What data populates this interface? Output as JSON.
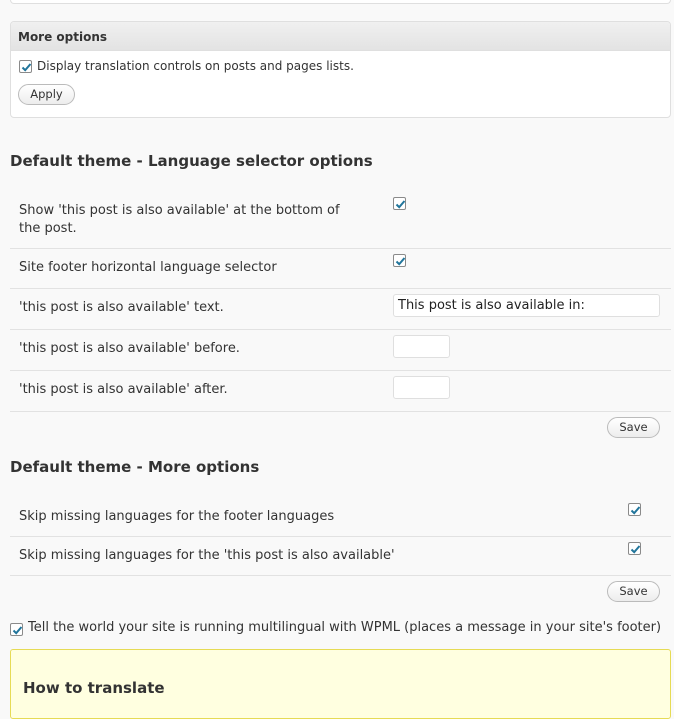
{
  "more_options": {
    "title": "More options",
    "display_controls_label": "Display translation controls on posts and pages lists.",
    "apply_label": "Apply"
  },
  "language_selector": {
    "title": "Default theme - Language selector options",
    "show_available_label_line1": "Show 'this post is also available' at the bottom of",
    "show_available_label_line2": "the post.",
    "footer_selector_label": "Site footer horizontal language selector",
    "available_text_label": "'this post is also available' text.",
    "available_text_value": "This post is also available in:",
    "before_label": "'this post is also available' before.",
    "before_value": "",
    "after_label": "'this post is also available' after.",
    "after_value": "",
    "save_label": "Save"
  },
  "theme_more_options": {
    "title": "Default theme - More options",
    "skip_footer_label": "Skip missing languages for the footer languages",
    "skip_available_label": "Skip missing languages for the 'this post is also available'",
    "save_label": "Save"
  },
  "tell_world_label": "Tell the world your site is running multilingual with WPML (places a message in your site's footer)",
  "how_to_translate": {
    "title": "How to translate"
  },
  "colors": {
    "checkmark": "#21759b",
    "notice_bg": "#ffffe0"
  }
}
